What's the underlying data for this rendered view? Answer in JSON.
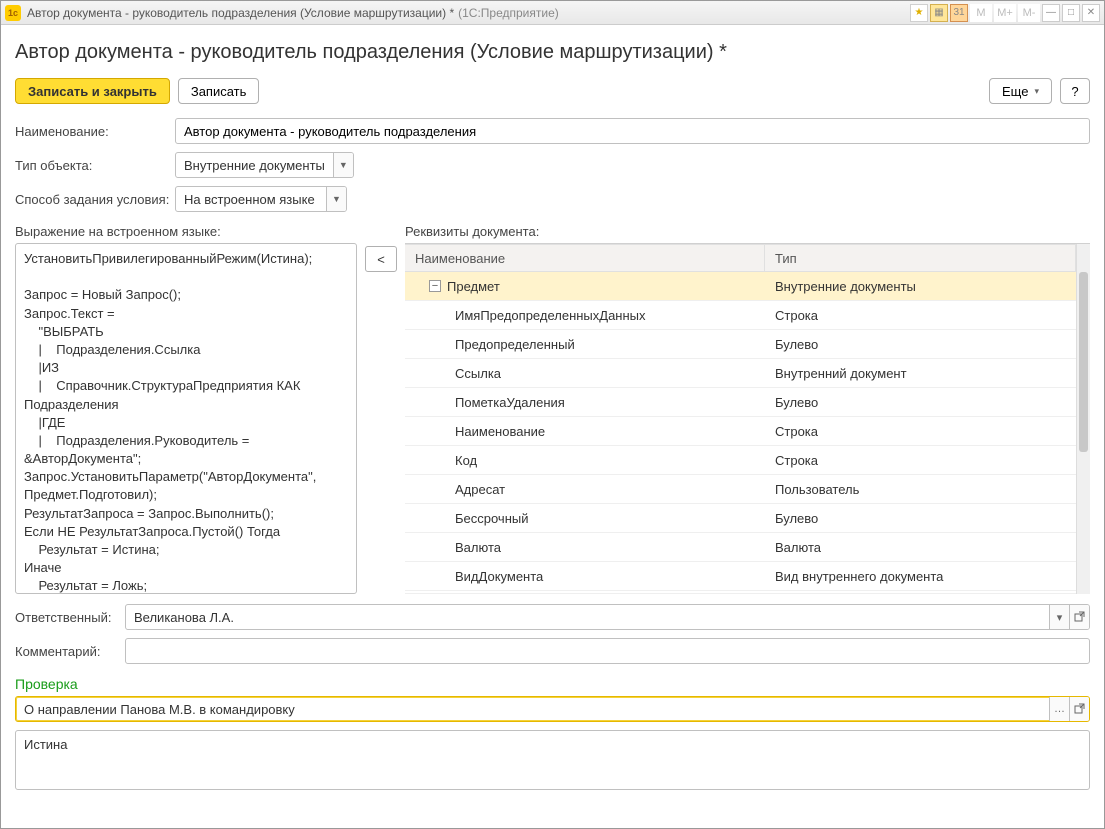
{
  "titlebar": {
    "title": "Автор документа - руководитель подразделения (Условие маршрутизации) *",
    "suffix": "(1С:Предприятие)",
    "mem_buttons": [
      "M",
      "M+",
      "M-"
    ]
  },
  "page_title": "Автор документа - руководитель подразделения (Условие маршрутизации) *",
  "toolbar": {
    "save_close": "Записать и закрыть",
    "save": "Записать",
    "more": "Еще",
    "help": "?"
  },
  "labels": {
    "name": "Наименование:",
    "object_type": "Тип объекта:",
    "condition_mode": "Способ задания условия:",
    "expression": "Выражение на встроенном языке:",
    "requisites": "Реквизиты документа:",
    "responsible": "Ответственный:",
    "comment": "Комментарий:",
    "check": "Проверка"
  },
  "fields": {
    "name": "Автор документа - руководитель подразделения",
    "object_type": "Внутренние документы",
    "condition_mode": "На встроенном языке",
    "expression": "УстановитьПривилегированныйРежим(Истина);\n\nЗапрос = Новый Запрос();\nЗапрос.Текст =\n    \"ВЫБРАТЬ\n    |    Подразделения.Ссылка\n    |ИЗ\n    |    Справочник.СтруктураПредприятия КАК Подразделения\n    |ГДЕ\n    |    Подразделения.Руководитель = &АвторДокумента\";\nЗапрос.УстановитьПараметр(\"АвторДокумента\", Предмет.Подготовил);\nРезультатЗапроса = Запрос.Выполнить();\nЕсли НЕ РезультатЗапроса.Пустой() Тогда\n    Результат = Истина;\nИначе\n    Результат = Ложь;\nКонецЕсли;\n\nУстановитьПривилегированныйРежим(Ложь);",
    "responsible": "Великанова Л.А.",
    "comment": "",
    "check_input": "О направлении Панова М.В. в командировку",
    "check_result": "Истина"
  },
  "tree": {
    "col_name": "Наименование",
    "col_type": "Тип",
    "rows": [
      {
        "name": "Предмет",
        "type": "Внутренние документы",
        "root": true
      },
      {
        "name": "ИмяПредопределенныхДанных",
        "type": "Строка"
      },
      {
        "name": "Предопределенный",
        "type": "Булево"
      },
      {
        "name": "Ссылка",
        "type": "Внутренний документ"
      },
      {
        "name": "ПометкаУдаления",
        "type": "Булево"
      },
      {
        "name": "Наименование",
        "type": "Строка"
      },
      {
        "name": "Код",
        "type": "Строка"
      },
      {
        "name": "Адресат",
        "type": "Пользователь"
      },
      {
        "name": "Бессрочный",
        "type": "Булево"
      },
      {
        "name": "Валюта",
        "type": "Валюта"
      },
      {
        "name": "ВидДокумента",
        "type": "Вид внутреннего документа"
      }
    ]
  },
  "insert_btn": "<"
}
